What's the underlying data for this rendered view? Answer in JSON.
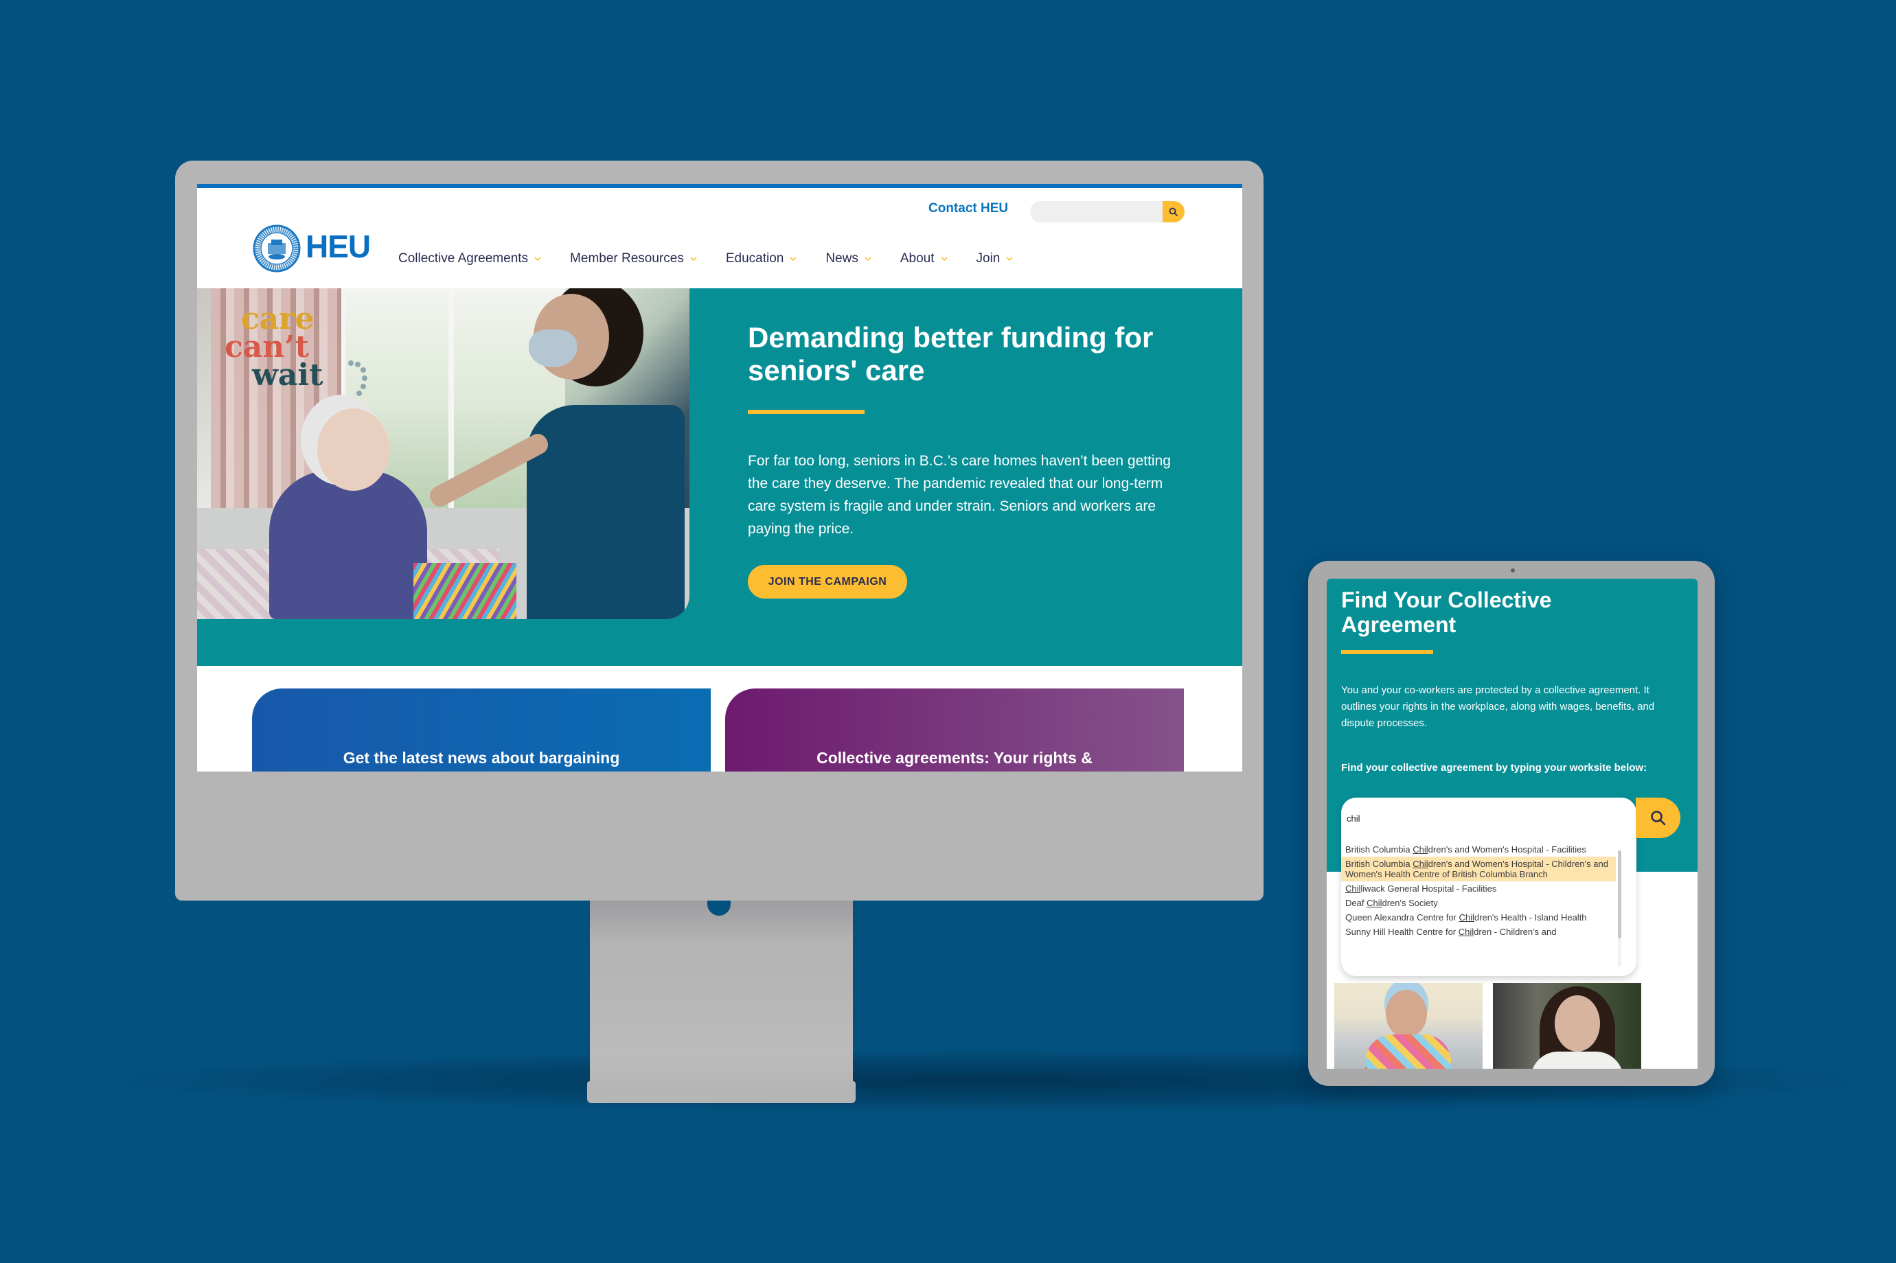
{
  "desktop": {
    "header": {
      "contact_link": "Contact HEU",
      "search": {
        "placeholder": "",
        "value": "",
        "button_icon": "search-icon"
      },
      "logo": {
        "text": "HEU",
        "seal_top": "HOSPITAL EMPLOYEES' UNION",
        "seal_bottom": "CUPE"
      },
      "nav": [
        {
          "label": "Collective Agreements",
          "icon": "chevron-down-icon"
        },
        {
          "label": "Member Resources",
          "icon": "chevron-down-icon"
        },
        {
          "label": "Education",
          "icon": "chevron-down-icon"
        },
        {
          "label": "News",
          "icon": "chevron-down-icon"
        },
        {
          "label": "About",
          "icon": "chevron-down-icon"
        },
        {
          "label": "Join",
          "icon": "chevron-down-icon"
        }
      ]
    },
    "hero": {
      "image_caption": {
        "line1": "care",
        "line2": "can’t",
        "line3": "wait"
      },
      "title": "Demanding better funding for seniors' care",
      "body": "For far too long, seniors in B.C.’s care homes haven’t been getting the care they deserve. The pandemic revealed that our long-term care system is fragile and under strain. Seniors and workers are paying the price.",
      "cta": "JOIN THE CAMPAIGN"
    },
    "cards": [
      {
        "title": "Get the latest news about bargaining"
      },
      {
        "title": "Collective agreements: Your rights &"
      }
    ]
  },
  "tablet": {
    "title": "Find Your Collective Agreement",
    "body": "You and your co-workers are protected by a collective agreement. It outlines your rights in the workplace, along with wages, benefits, and dispute processes.",
    "search_label": "Find your collective agreement by typing your worksite below:",
    "search_value": "chil",
    "search_button_icon": "search-icon",
    "results": [
      {
        "before": "British Columbia ",
        "match": "Chil",
        "after": "dren's and Women's Hospital - Facilities",
        "highlighted": false
      },
      {
        "before": "British Columbia ",
        "match": "Chil",
        "after": "dren's and Women's Hospital - Children's and Women's Health Centre of British Columbia Branch",
        "highlighted": true
      },
      {
        "before": "",
        "match": "Chil",
        "after": "liwack General Hospital - Facilities",
        "highlighted": false
      },
      {
        "before": "Deaf ",
        "match": "Chil",
        "after": "dren's Society",
        "highlighted": false
      },
      {
        "before": "Queen Alexandra Centre for ",
        "match": "Chil",
        "after": "dren's Health - Island Health",
        "highlighted": false
      },
      {
        "before": "Sunny Hill Health Centre for ",
        "match": "Chil",
        "after": "dren - Children's and",
        "highlighted": false
      }
    ]
  },
  "colors": {
    "background": "#03517e",
    "brand_blue": "#0a6fc0",
    "teal": "#078f96",
    "accent_yellow": "#fcbd31",
    "nav_text": "#2a2c50",
    "highlight": "#fde3ae"
  }
}
